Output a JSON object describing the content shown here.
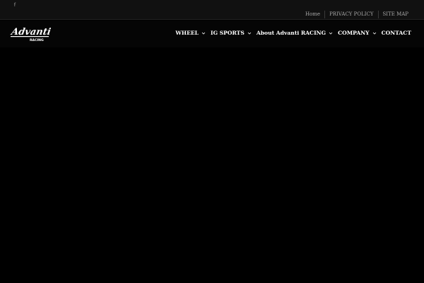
{
  "topbar": {
    "social": [
      {
        "name": "facebook-icon",
        "glyph": "f"
      }
    ],
    "links": [
      {
        "label": "Home"
      },
      {
        "label": "PRIVACY POLICY"
      },
      {
        "label": "SITE MAP"
      }
    ]
  },
  "header": {
    "logo": {
      "brand": "Advanti",
      "sub": "RACING"
    },
    "nav": [
      {
        "label": "WHEEL",
        "has_dropdown": true
      },
      {
        "label": "IG SPORTS",
        "has_dropdown": true
      },
      {
        "label": "About Advanti RACING",
        "has_dropdown": true
      },
      {
        "label": "COMPANY",
        "has_dropdown": true
      },
      {
        "label": "CONTACT",
        "has_dropdown": false
      }
    ]
  },
  "colors": {
    "background": "#000000",
    "topbar": "#111111",
    "nav_text": "#ffffff",
    "top_link_text": "#a8a8a8"
  }
}
